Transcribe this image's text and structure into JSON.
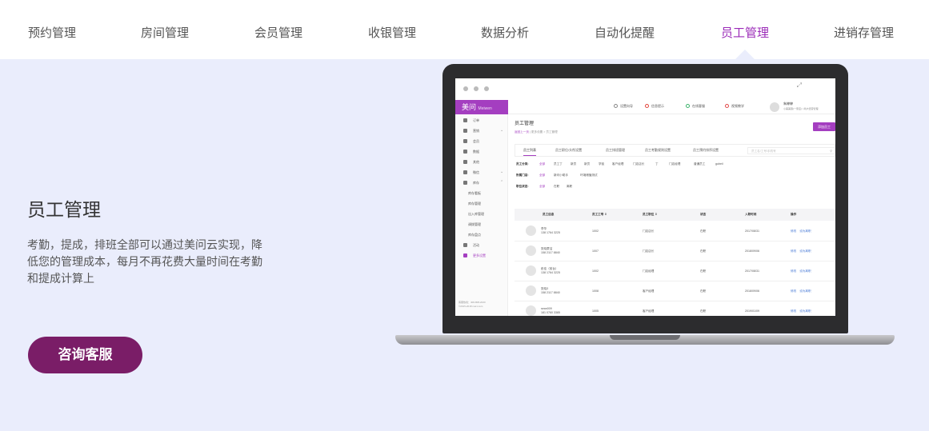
{
  "top_nav": {
    "tabs": [
      {
        "label": "预约管理",
        "active": false
      },
      {
        "label": "房间管理",
        "active": false
      },
      {
        "label": "会员管理",
        "active": false
      },
      {
        "label": "收银管理",
        "active": false
      },
      {
        "label": "数据分析",
        "active": false
      },
      {
        "label": "自动化提醒",
        "active": false
      },
      {
        "label": "员工管理",
        "active": true
      },
      {
        "label": "进销存管理",
        "active": false
      }
    ],
    "active_color": "#9b2bb8"
  },
  "feature": {
    "title": "员工管理",
    "description": "考勤，提成，排班全部可以通过美问云实现，降低您的管理成本，每月不再花费大量时间在考勤和提成计算上",
    "button_label": "咨询客服",
    "button_color": "#7a1d67"
  },
  "mockup": {
    "logo": "美问",
    "logo_sub": "Meiwen",
    "header_items": [
      {
        "label": "设置向导",
        "icon": "gear-icon"
      },
      {
        "label": "信息提示",
        "icon": "bell-icon"
      },
      {
        "label": "在线客服",
        "icon": "chat-icon"
      },
      {
        "label": "视频教学",
        "icon": "play-icon"
      }
    ],
    "user": {
      "name": "朱婷婷",
      "role": "小美美容(一家店) / 商户经营管理"
    },
    "sidebar": [
      {
        "label": "订单",
        "icon": "order-icon"
      },
      {
        "label": "营销",
        "icon": "marketing-icon",
        "caret": "⌄"
      },
      {
        "label": "会员",
        "icon": "member-icon"
      },
      {
        "label": "数据",
        "icon": "data-icon"
      },
      {
        "label": "其他",
        "icon": "other-icon"
      },
      {
        "label": "微信",
        "icon": "wechat-icon",
        "caret": "⌄"
      },
      {
        "label": "库存",
        "icon": "inventory-icon",
        "caret": "⌃"
      },
      {
        "label": "库存看板",
        "sub": true
      },
      {
        "label": "库存管理",
        "sub": true
      },
      {
        "label": "出入库管理",
        "sub": true
      },
      {
        "label": "调拨管理",
        "sub": true
      },
      {
        "label": "库存盘点",
        "sub": true
      },
      {
        "label": "活动",
        "icon": "activity-icon"
      },
      {
        "label": "更多设置",
        "icon": "settings-icon",
        "active": true
      }
    ],
    "sidebar_footer": [
      "客服热线：400-808-2020",
      "©2015-2018 mei1.com"
    ],
    "page_title": "员工管理",
    "breadcrumb_back": "返回上一页",
    "breadcrumb_rest": " | 更多设置 > 员工管理",
    "add_button": "添加员工",
    "tabs": [
      "员工列表",
      "员工职位/头衔设置",
      "员工排班管理",
      "员工考勤规则设置",
      "员工预约排序设置"
    ],
    "search_placeholder": "员工名/工号/手机号",
    "search_icon": "⚲",
    "filters": [
      {
        "label": "员工分类:",
        "options": [
          "全部",
          "员工丁",
          "新员",
          "新员",
          "学徒",
          "客户经理",
          "门店店长",
          "丁",
          "门店经理",
          "普通员工",
          "gubeil"
        ],
        "selected": 0
      },
      {
        "label": "所属门店:",
        "options": [
          "全部",
          "新问小助手",
          "环境储值测试"
        ],
        "selected": 0
      },
      {
        "label": "职位状态:",
        "options": [
          "全部",
          "在职",
          "离职"
        ],
        "selected": 0
      }
    ],
    "table_headers": [
      "员工信息",
      "员工工号 ⇕",
      "员工职位 ⇕",
      "状态",
      "入职时间",
      "操作"
    ],
    "rows": [
      {
        "name": "李华",
        "phone": "138 1764 3225",
        "id": "1002",
        "position": "门店店长",
        "status": "在职",
        "date": "2017/08/31"
      },
      {
        "name": "张晓蒙洁",
        "phone": "158 2117 8840",
        "id": "1007",
        "position": "门店店长",
        "status": "在职",
        "date": "2018/09/06"
      },
      {
        "name": "彭佳（前台）",
        "phone": "138 1764 3225",
        "id": "1002",
        "position": "门店经理",
        "status": "在职",
        "date": "2017/08/31"
      },
      {
        "name": "张晓3",
        "phone": "158 2117 8840",
        "id": "1008",
        "position": "客户经理",
        "status": "在职",
        "date": "2018/09/06"
      },
      {
        "name": "sean009",
        "phone": "181 0760 3385",
        "id": "1005",
        "position": "客户经理",
        "status": "在职",
        "date": "2019/01/09"
      }
    ],
    "row_actions": [
      "修改",
      "设为离职"
    ],
    "accent_color": "#a43ec0"
  }
}
